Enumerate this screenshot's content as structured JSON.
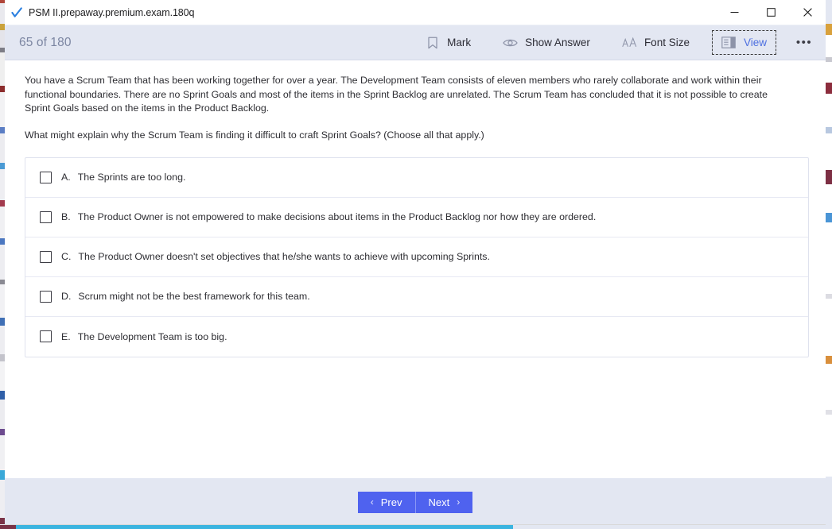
{
  "window": {
    "title": "PSM II.prepaway.premium.exam.180q",
    "app_icon": "checkmark-icon",
    "controls": {
      "minimize": "—",
      "maximize": "□",
      "close": "✕"
    }
  },
  "toolbar": {
    "progress": "65 of 180",
    "actions": [
      {
        "label": "Mark",
        "icon": "bookmark-icon",
        "focused": false
      },
      {
        "label": "Show Answer",
        "icon": "eye-icon",
        "focused": false
      },
      {
        "label": "Font Size",
        "icon": "font-size-icon",
        "focused": false
      },
      {
        "label": "View",
        "icon": "layout-panel-icon",
        "focused": true
      }
    ],
    "overflow": "•••"
  },
  "question": {
    "stem": "You have a Scrum Team that has been working together for over a year. The Development Team consists of eleven members who rarely collaborate and work within their functional boundaries. There are no Sprint Goals and most of the items in the Sprint Backlog are unrelated. The Scrum Team has concluded that it is not possible to create Sprint Goals based on the items in the Product Backlog.",
    "prompt": "What might explain why the Scrum Team is finding it difficult to craft Sprint Goals? (Choose all that apply.)",
    "options": [
      {
        "letter": "A.",
        "text": "The Sprints are too long.",
        "checked": false
      },
      {
        "letter": "B.",
        "text": "The Product Owner is not empowered to make decisions about items in the Product Backlog nor how they are ordered.",
        "checked": false
      },
      {
        "letter": "C.",
        "text": "The Product Owner doesn't set objectives that he/she wants to achieve with upcoming Sprints.",
        "checked": false
      },
      {
        "letter": "D.",
        "text": "Scrum might not be the best framework for this team.",
        "checked": false
      },
      {
        "letter": "E.",
        "text": "The Development Team is too big.",
        "checked": false
      }
    ]
  },
  "footer": {
    "prev_label": "Prev",
    "next_label": "Next",
    "prev_chevron": "‹",
    "next_chevron": "›"
  },
  "colors": {
    "toolbar_bg": "#e3e7f2",
    "accent_blue": "#4f62ef",
    "view_active_text": "#4d6fe0",
    "progress_text": "#7c86a2",
    "body_text": "#2e2e33"
  }
}
